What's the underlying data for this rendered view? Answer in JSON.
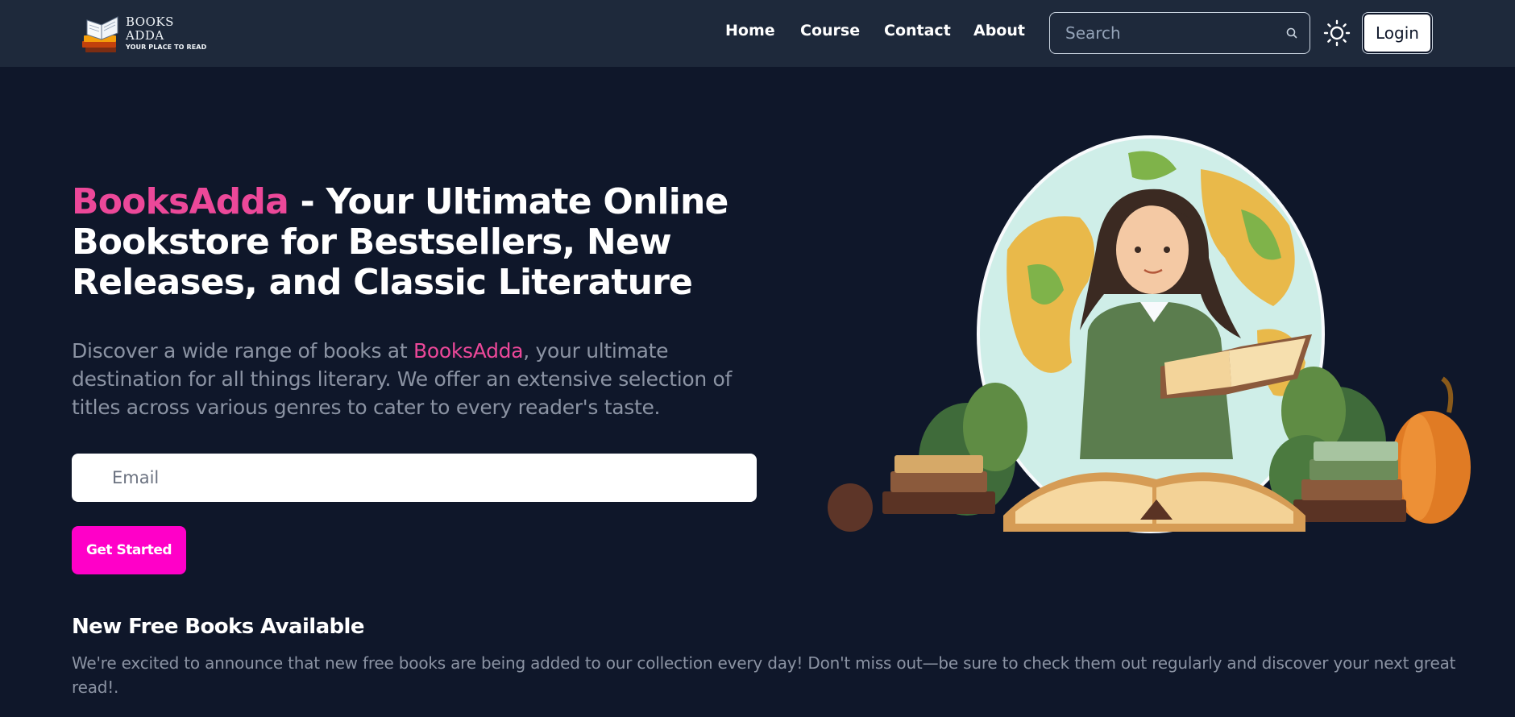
{
  "navbar": {
    "logo": {
      "line1": "BOOKS",
      "line2": "ADDA",
      "tagline": "YOUR PLACE TO READ"
    },
    "links": [
      "Home",
      "Course",
      "Contact",
      "About"
    ],
    "search": {
      "placeholder": "Search",
      "icon": "search-icon"
    },
    "theme_icon": "sun-icon",
    "login_label": "Login"
  },
  "hero": {
    "title_brand": "BooksAdda",
    "title_rest": " - Your Ultimate Online Bookstore for Bestsellers, New Releases, and Classic Literature",
    "desc_before": "Discover a wide range of books at ",
    "desc_brand": "BooksAdda",
    "desc_after": ", your ultimate destination for all things literary. We offer an extensive selection of titles across various genres to cater to every reader's taste.",
    "email_placeholder": "Email",
    "cta_label": "Get Started"
  },
  "free_books": {
    "title": "New Free Books Available",
    "text": "We're excited to announce that new free books are being added to our collection every day! Don't miss out—be sure to check them out regularly and discover your next great read!."
  },
  "colors": {
    "background": "#0f172a",
    "navbar": "#1e293b",
    "brand_pink": "#ec4899",
    "cta": "#ff00c8",
    "muted_text": "#8b93a3"
  }
}
